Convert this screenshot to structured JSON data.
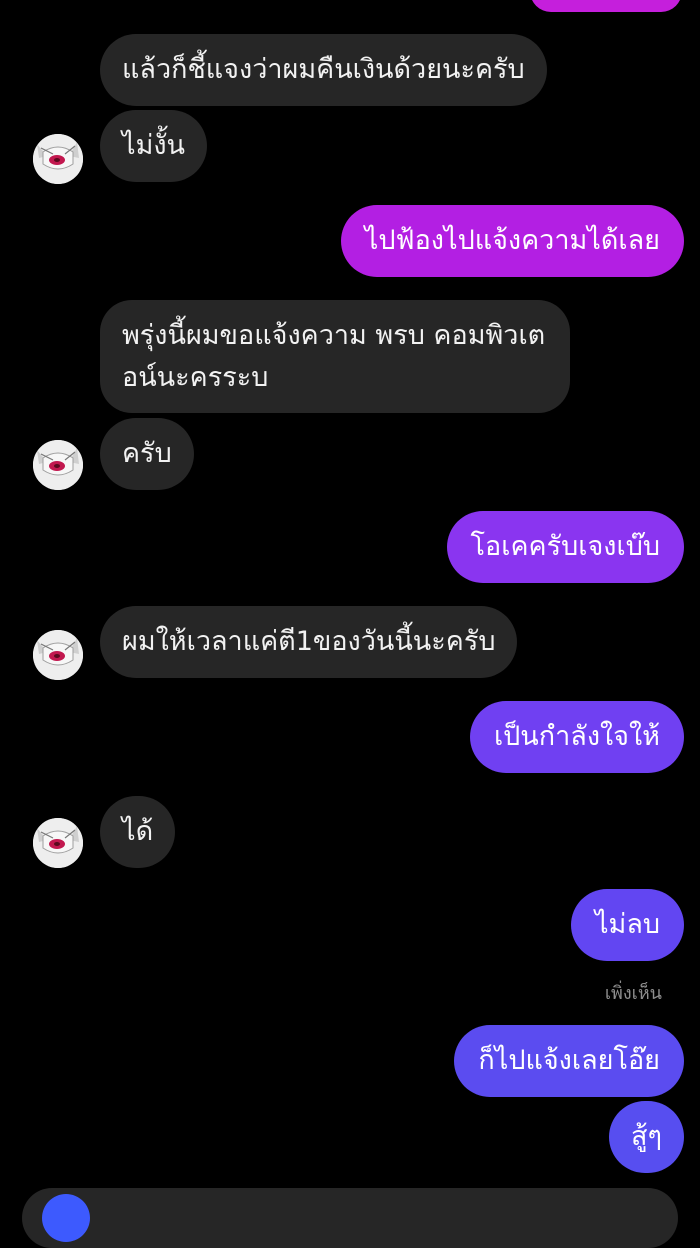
{
  "thread": {
    "messages": [
      {
        "dir": "out",
        "text": ""
      },
      {
        "dir": "in",
        "text": "แล้วก็ชี้แจงว่าผมคืนเงินด้วยนะครับ"
      },
      {
        "dir": "in",
        "text": "ไม่งั้น"
      },
      {
        "dir": "out",
        "text": "ไปฟ้องไปแจ้งความได้เลย"
      },
      {
        "dir": "in",
        "text": "พรุ่งนี้ผมขอแจ้งความ พรบ คอมพิวเตอน์นะครระบ"
      },
      {
        "dir": "in",
        "text": "ครับ"
      },
      {
        "dir": "out",
        "text": "โอเคครับเจงเบ๊บ"
      },
      {
        "dir": "in",
        "text": "ผมให้เวลาแค่ตี1ของวันนี้นะครับ"
      },
      {
        "dir": "out",
        "text": "เป็นกำลังใจให้"
      },
      {
        "dir": "in",
        "text": "ได้"
      },
      {
        "dir": "out",
        "text": "ไม่ลบ"
      },
      {
        "dir": "out",
        "text": "ก็ไปแจ้งเลยโอ๊ย"
      },
      {
        "dir": "out",
        "text": "สู้ๆ"
      }
    ],
    "seen_label": "เพิ่งเห็น"
  },
  "colors": {
    "incoming_bubble": "#262626",
    "outgoing_gradient_top": "#c21ee0",
    "outgoing_gradient_mid": "#8a35f0",
    "outgoing_gradient_bottom": "#5b4cf0",
    "background": "#000000"
  },
  "icons": {
    "avatar": "anime-character-avatar",
    "composer": "camera-icon"
  }
}
